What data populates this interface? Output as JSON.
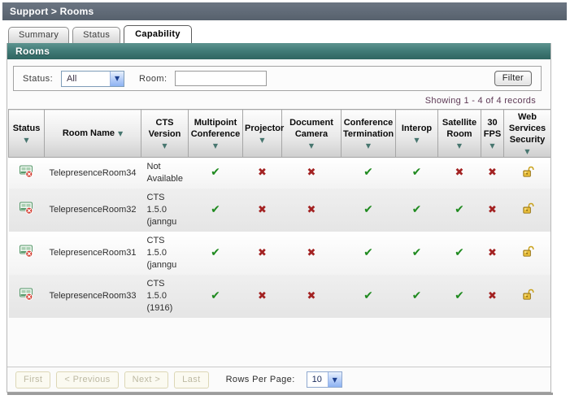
{
  "window": {
    "title": "Support > Rooms"
  },
  "tabs": [
    {
      "label": "Summary",
      "active": false
    },
    {
      "label": "Status",
      "active": false
    },
    {
      "label": "Capability",
      "active": true
    }
  ],
  "section_header": "Rooms",
  "filter_bar": {
    "status_label": "Status:",
    "status_value": "All",
    "room_label": "Room:",
    "room_value": "",
    "filter_button": "Filter"
  },
  "records_summary": "Showing 1 - 4 of 4 records",
  "table": {
    "columns": [
      {
        "label": "Status",
        "arrow": "below"
      },
      {
        "label": "Room Name",
        "arrow": "inline"
      },
      {
        "label": "CTS Version",
        "arrow": "below"
      },
      {
        "label": "Multipoint Conference",
        "arrow": "below"
      },
      {
        "label": "Projector",
        "arrow": "below"
      },
      {
        "label": "Document Camera",
        "arrow": "below"
      },
      {
        "label": "Conference Termination",
        "arrow": "below"
      },
      {
        "label": "Interop",
        "arrow": "below"
      },
      {
        "label": "Satellite Room",
        "arrow": "below"
      },
      {
        "label": "30 FPS",
        "arrow": "below"
      },
      {
        "label": "Web Services Security",
        "arrow": "below"
      }
    ],
    "capability_keys": [
      "multipoint_conference",
      "projector",
      "document_camera",
      "conference_termination",
      "interop",
      "satellite_room",
      "30_fps"
    ],
    "rows": [
      {
        "status": "room-error",
        "room_name": "TelepresenceRoom34",
        "cts_version": "Not Available",
        "capabilities": [
          "yes",
          "no",
          "no",
          "yes",
          "yes",
          "no",
          "no"
        ],
        "web_services_security": "unlocked"
      },
      {
        "status": "room-error",
        "room_name": "TelepresenceRoom32",
        "cts_version": "CTS 1.5.0 (janngu",
        "capabilities": [
          "yes",
          "no",
          "no",
          "yes",
          "yes",
          "yes",
          "no"
        ],
        "web_services_security": "unlocked"
      },
      {
        "status": "room-error",
        "room_name": "TelepresenceRoom31",
        "cts_version": "CTS 1.5.0 (janngu",
        "capabilities": [
          "yes",
          "no",
          "no",
          "yes",
          "yes",
          "yes",
          "no"
        ],
        "web_services_security": "unlocked"
      },
      {
        "status": "room-error",
        "room_name": "TelepresenceRoom33",
        "cts_version": "CTS 1.5.0 (1916)",
        "capabilities": [
          "yes",
          "no",
          "no",
          "yes",
          "yes",
          "yes",
          "no"
        ],
        "web_services_security": "unlocked"
      }
    ]
  },
  "pagination": {
    "first": "First",
    "previous": "< Previous",
    "next": "Next >",
    "last": "Last",
    "rows_per_page_label": "Rows Per Page:",
    "rows_per_page_value": "10"
  },
  "colors": {
    "title_bar": "#5d6773",
    "section_teal": "#3f7d79",
    "check_green": "#1f8a1f",
    "cross_red": "#a32222",
    "records_text": "#5e3a56",
    "lock_gold": "#e7bd3a"
  }
}
